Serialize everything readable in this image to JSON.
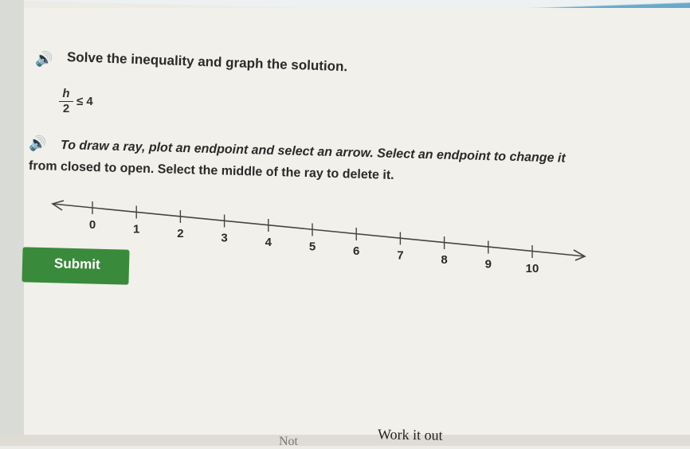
{
  "question": {
    "prompt": "Solve the inequality and graph the solution.",
    "fraction_numerator": "h",
    "fraction_denominator": "2",
    "inequality_rest": "≤ 4"
  },
  "instructions": {
    "line1": "To draw a ray, plot an endpoint and select an arrow. Select an endpoint to change it",
    "line2": "from closed to open. Select the middle of the ray to delete it."
  },
  "number_line": {
    "min": 0,
    "max": 10,
    "tick_labels": [
      "0",
      "1",
      "2",
      "3",
      "4",
      "5",
      "6",
      "7",
      "8",
      "9",
      "10"
    ]
  },
  "buttons": {
    "submit_label": "Submit"
  },
  "footer": {
    "work_label": "Work it out",
    "notes_label": "Not"
  },
  "icons": {
    "speaker": "speaker-icon"
  }
}
